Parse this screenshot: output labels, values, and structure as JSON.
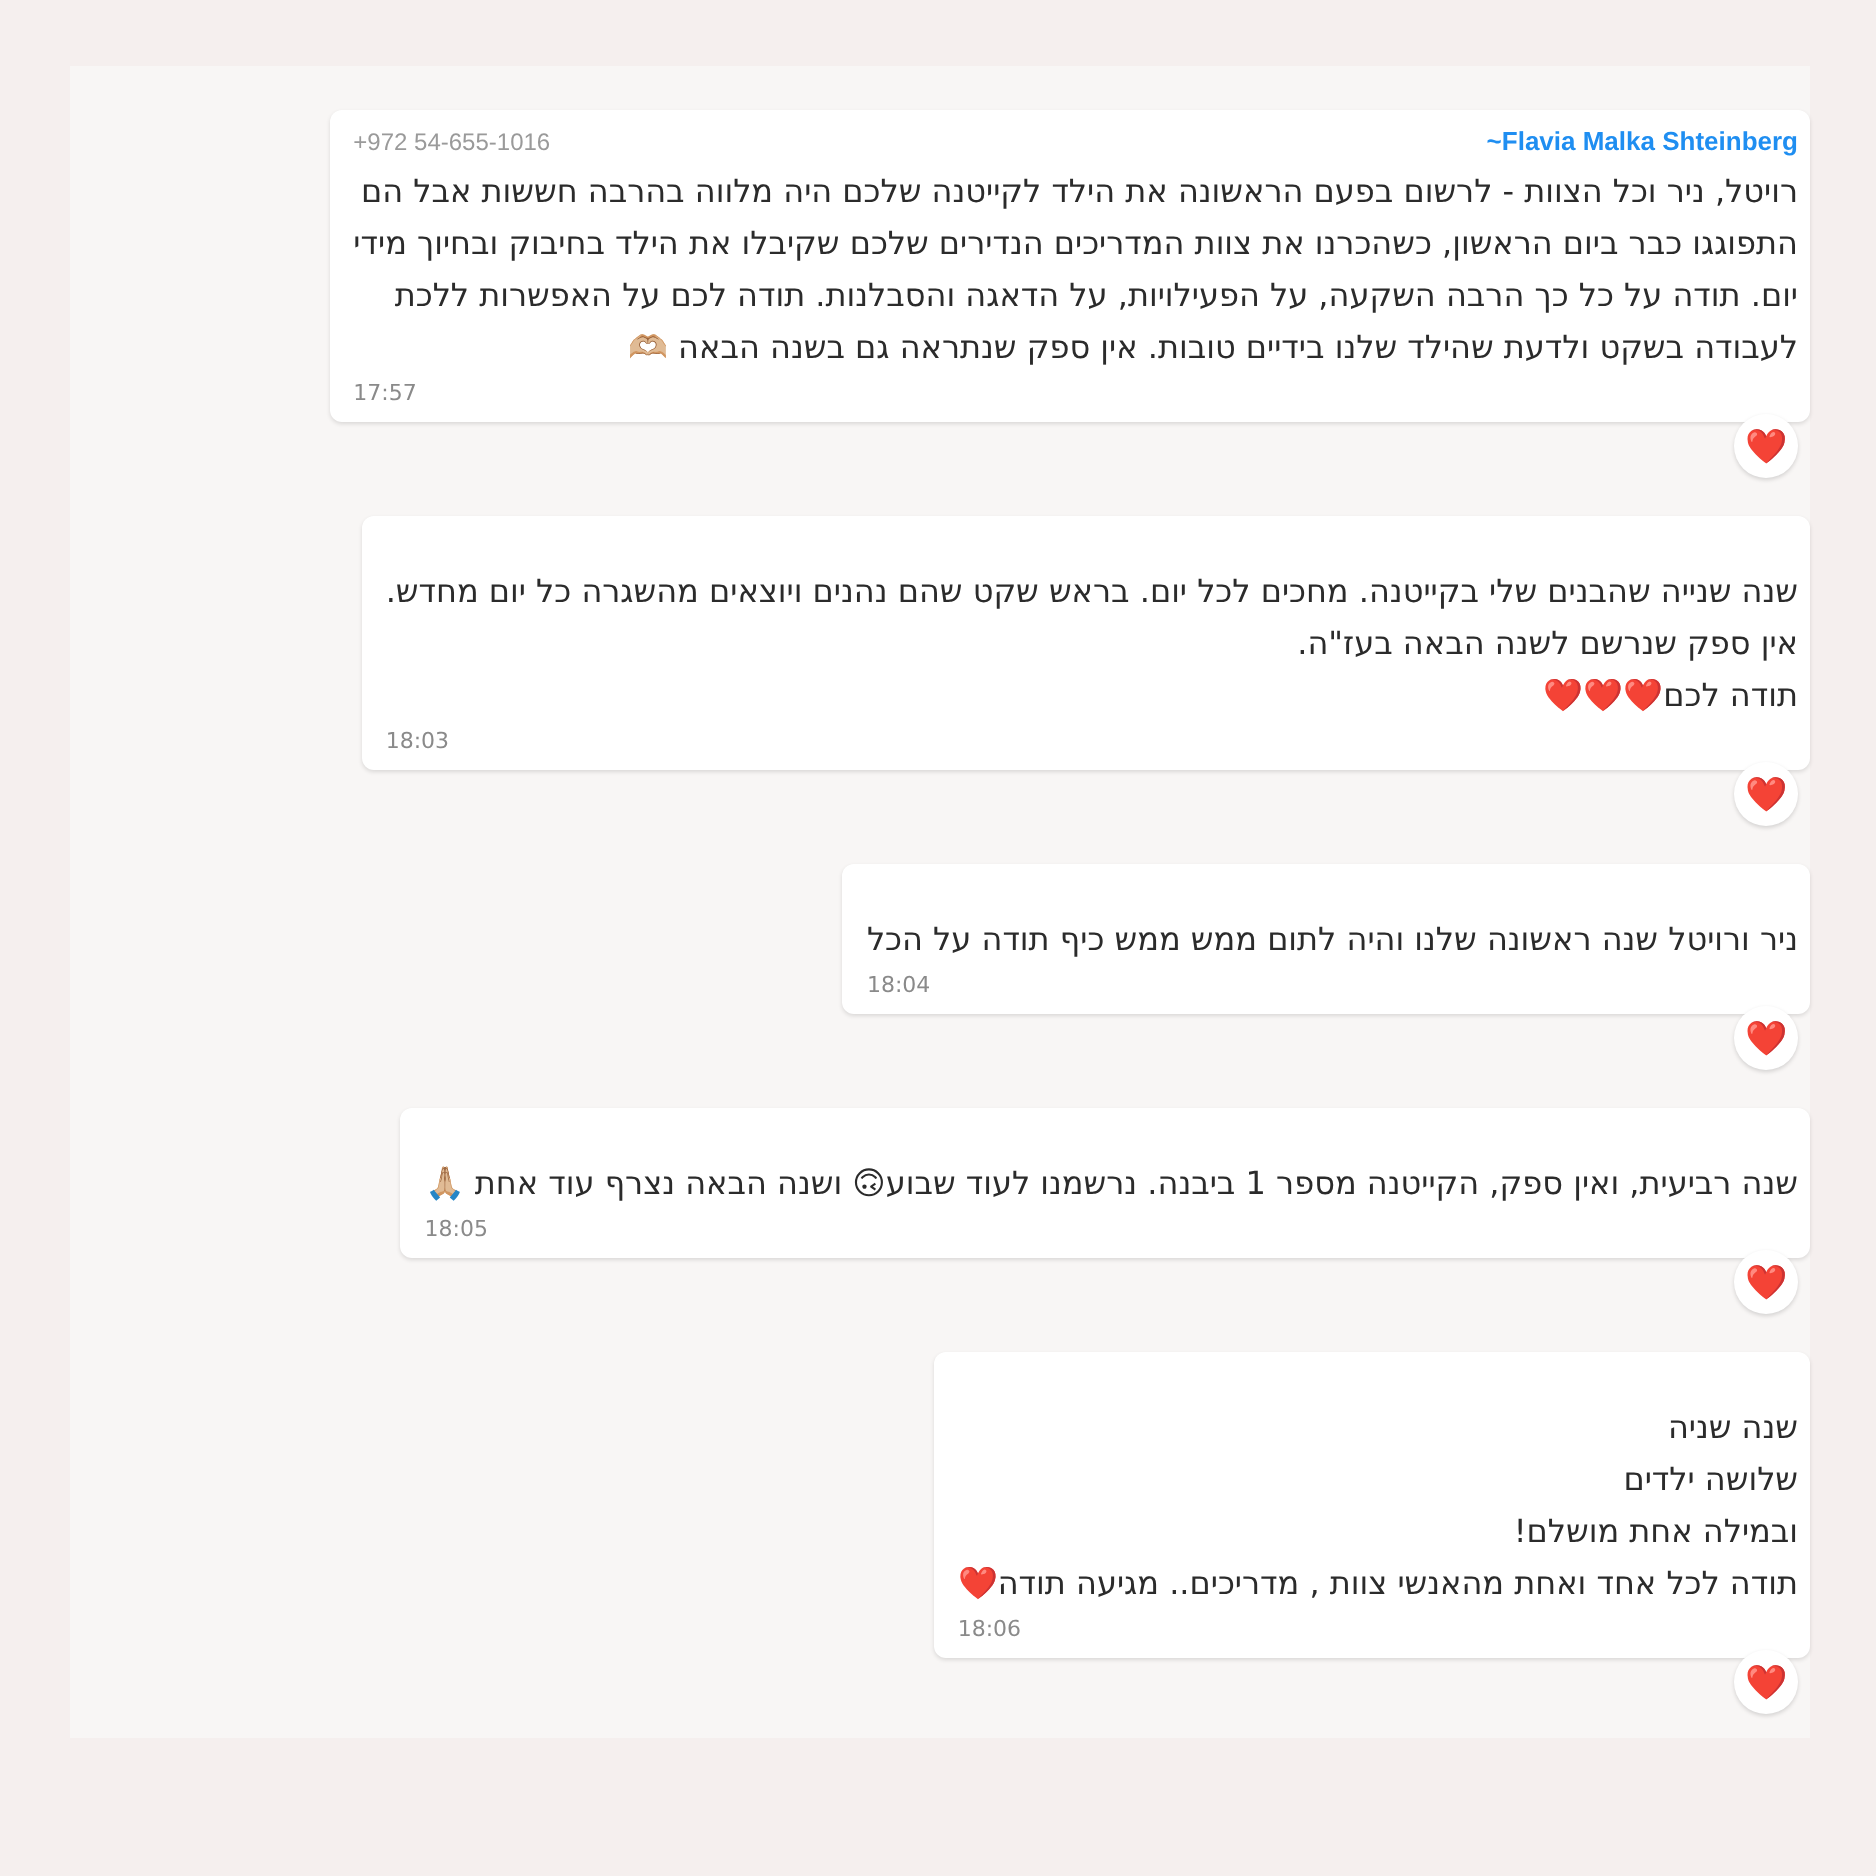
{
  "messages": [
    {
      "sender": "~Flavia Malka Shteinberg",
      "phone": "+972 54-655-1016",
      "lines": [
        "רויטל, ניר וכל הצוות - לרשום בפעם הראשונה את הילד לקייטנה שלכם היה מלווה בהרבה חששות אבל הם",
        "התפוגגו כבר ביום הראשון, כשהכרנו את צוות המדריכים הנדירים שלכם שקיבלו את הילד בחיבוק ובחיוך מידי",
        "יום. תודה על כל כך הרבה השקעה, על הפעילויות, על הדאגה והסבלנות. תודה לכם על האפשרות ללכת",
        "לעבודה בשקט ולדעת שהילד שלנו בידיים טובות. אין ספק שנתראה גם בשנה הבאה 🫶🏼"
      ],
      "time": "17:57",
      "reaction": "❤️"
    },
    {
      "lines": [
        "שנה שנייה שהבנים שלי בקייטנה. מחכים לכל יום. בראש שקט שהם נהנים ויוצאים מהשגרה כל יום מחדש.",
        "אין ספק שנרשם לשנה הבאה בעז\"ה.",
        "תודה לכם❤️❤️❤️"
      ],
      "time": "18:03",
      "reaction": "❤️"
    },
    {
      "lines": [
        "ניר ורויטל שנה ראשונה שלנו והיה לתום ממש ממש כיף תודה על הכל"
      ],
      "time": "18:04",
      "reaction": "❤️"
    },
    {
      "lines": [
        "שנה רביעית, ואין ספק, הקייטנה מספר 1 ביבנה. נרשמנו לעוד שבוע🙃 ושנה הבאה נצרף עוד אחת 🙏🏼"
      ],
      "time": "18:05",
      "reaction": "❤️"
    },
    {
      "lines": [
        "שנה שניה",
        "שלושה ילדים",
        "ובמילה אחת מושלם!",
        "תודה לכל אחד ואחת מהאנשי צוות , מדריכים..  מגיעה תודה❤️"
      ],
      "time": "18:06",
      "reaction": "❤️"
    }
  ]
}
